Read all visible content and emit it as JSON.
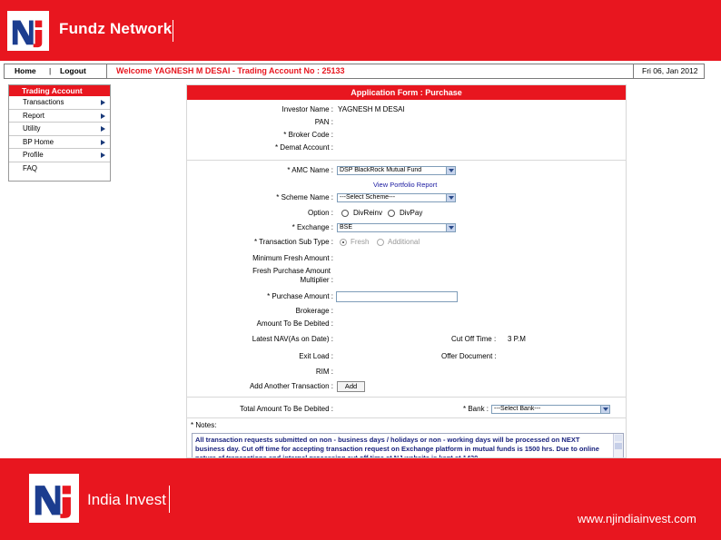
{
  "top_banner": {
    "brand": "Fundz Network",
    "logo_text": "nj"
  },
  "nav": {
    "home": "Home",
    "separator": "|",
    "logout": "Logout",
    "welcome": "Welcome YAGNESH M DESAI - Trading Account No : 25133",
    "date": "Fri 06, Jan 2012"
  },
  "sidebar": {
    "header": "Trading  Account",
    "items": [
      {
        "label": "Transactions",
        "has_submenu": true
      },
      {
        "label": "Report",
        "has_submenu": true
      },
      {
        "label": "Utility",
        "has_submenu": true
      },
      {
        "label": "BP Home",
        "has_submenu": true
      },
      {
        "label": "Profile",
        "has_submenu": true
      },
      {
        "label": "FAQ",
        "has_submenu": false
      }
    ]
  },
  "form": {
    "title": "Application Form : Purchase",
    "investor_name_label": "Investor Name :",
    "investor_name_value": "YAGNESH M DESAI",
    "pan_label": "PAN :",
    "broker_code_label": "* Broker Code :",
    "demat_account_label": "* Demat Account :",
    "amc_name_label": "* AMC Name :",
    "amc_name_value": "DSP BlackRock Mutual Fund",
    "view_portfolio_link": "View Portfolio Report",
    "scheme_name_label": "* Scheme Name :",
    "scheme_name_value": "---Select Scheme---",
    "option_label": "Option :",
    "option_values": [
      "DivReinv",
      "DivPay"
    ],
    "exchange_label": "* Exchange :",
    "exchange_value": "BSE",
    "transaction_subtype_label": "* Transaction Sub Type :",
    "transaction_subtype_values": [
      "Fresh",
      "Additional"
    ],
    "min_fresh_label": "Minimum Fresh Amount :",
    "fresh_multiplier_label_1": "Fresh Purchase Amount",
    "fresh_multiplier_label_2": "Multiplier :",
    "purchase_amount_label": "* Purchase Amount :",
    "brokerage_label": "Brokerage :",
    "amount_debited_label": "Amount To Be Debited :",
    "latest_nav_label": "Latest NAV(As on Date) :",
    "cutoff_time_label": "Cut Off Time :",
    "cutoff_time_value": "3 P.M",
    "exit_load_label": "Exit Load :",
    "offer_document_label": "Offer Document :",
    "rim_label": "RIM :",
    "add_another_label": "Add Another Transaction :",
    "add_button": "Add",
    "total_amount_label": "Total Amount To Be Debited :",
    "bank_label": "* Bank :",
    "bank_value": "---Select Bank---",
    "notes_label": "* Notes:",
    "notes_text": "All transaction requests submitted on non - business days / holidays or non - working days will be processed on NEXT business day. Cut off time for accepting transaction request on Exchange platform in mutual funds is 1500 hrs. Due to online nature of transactions and internal processing cut off time at NJ website is kept at 1430"
  },
  "bottom_banner": {
    "brand": "India Invest",
    "url": "www.njindiainvest.com",
    "logo_text": "nj"
  },
  "colors": {
    "brand_red": "#e8161f",
    "link_blue": "#1a1aa0",
    "notes_blue": "#1a237e"
  }
}
